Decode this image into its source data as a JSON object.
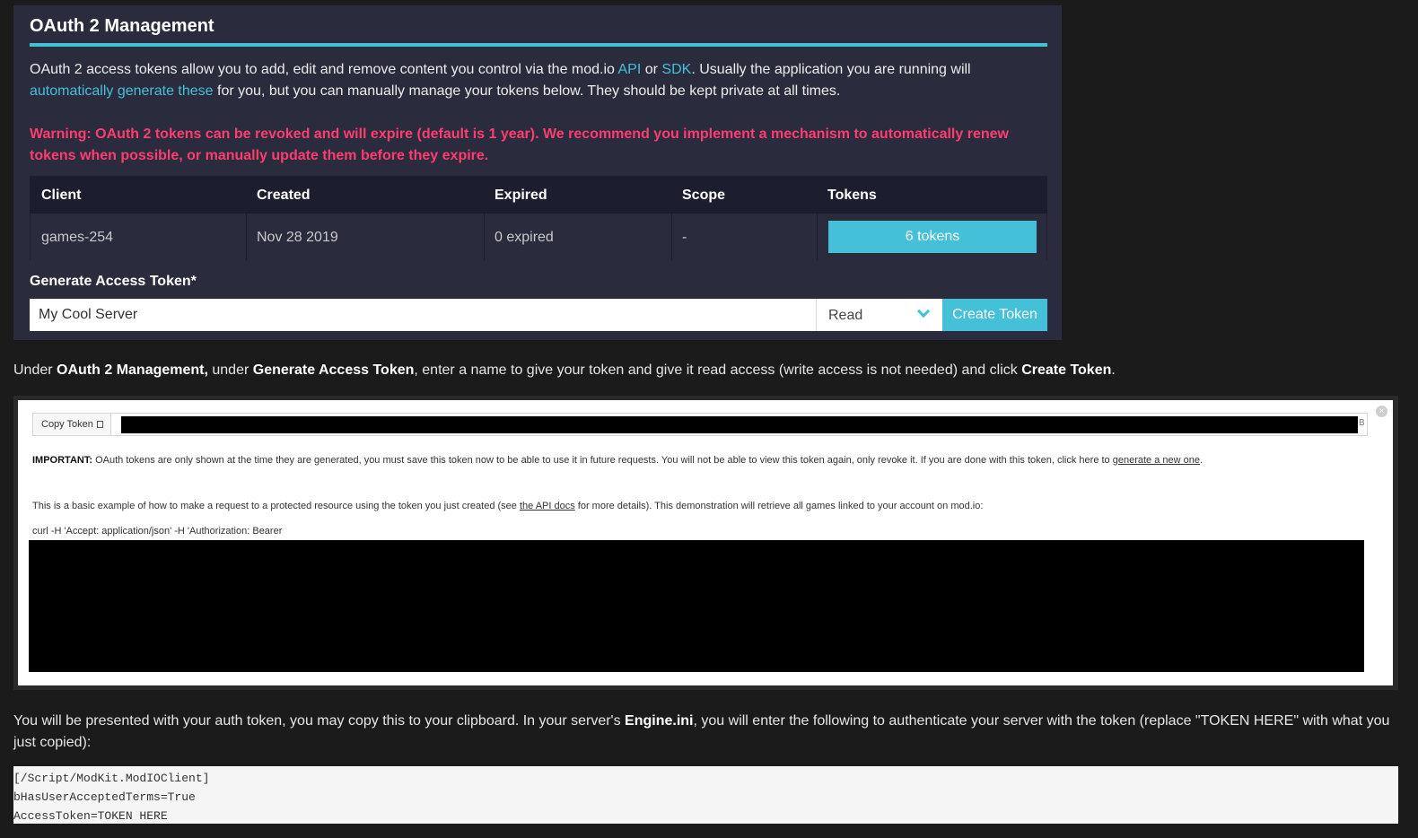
{
  "panel": {
    "title": "OAuth 2 Management",
    "desc_1": "OAuth 2 access tokens allow you to add, edit and remove content you control via the mod.io ",
    "link_api": "API",
    "desc_or": " or ",
    "link_sdk": "SDK",
    "desc_2": ". Usually the application you are running will ",
    "link_auto": "automatically generate these",
    "desc_3": " for you, but you can manually manage your tokens below. They should be kept private at all times.",
    "warning": "Warning: OAuth 2 tokens can be revoked and will expire (default is 1 year). We recommend you implement a mechanism to automatically renew tokens when possible, or manually update them before they expire.",
    "colors": {
      "accent": "#44c1d8",
      "warning": "#ff3d6e",
      "panel_bg": "#2a2b3d"
    }
  },
  "table": {
    "headers": [
      "Client",
      "Created",
      "Expired",
      "Scope",
      "Tokens"
    ],
    "row": {
      "client": "games-254",
      "created": "Nov 28 2019",
      "expired": "0 expired",
      "scope": "-",
      "tokens_button": "6 tokens"
    }
  },
  "generate": {
    "label": "Generate Access Token*",
    "input_value": "My Cool Server",
    "scope_selected": "Read",
    "create_button": "Create Token"
  },
  "instruction1": {
    "a": "Under ",
    "b": "OAuth 2 Management,",
    "c": " under ",
    "d": "Generate Access Token",
    "e": ", enter a name to give your token and give it read access (write access is not needed) and click ",
    "f": "Create Token",
    "g": "."
  },
  "token_panel": {
    "copy_button": "Copy Token",
    "token_tail": "B",
    "important_label": "IMPORTANT:",
    "important_text": " OAuth tokens are only shown at the time they are generated, you must save this token now to be able to use it in future requests. You will not be able to view this token again, only revoke it. If you are done with this token, click here to ",
    "important_link": "generate a new one",
    "important_end": ".",
    "example_1": "This is a basic example of how to make a request to a protected resource using the token you just created (see ",
    "example_link": "the API docs",
    "example_2": " for more details). This demonstration will retrieve all games linked to your account on mod.io:",
    "curl": "curl -H 'Accept: application/json' -H 'Authorization: Bearer"
  },
  "instruction2": {
    "a": "You will be presented with your auth token, you may copy this to your clipboard. In your server's ",
    "b": "Engine.ini",
    "c": ", you will enter the following to authenticate your server with the token (replace \"TOKEN HERE\" with what you just copied):"
  },
  "code": {
    "lines": [
      "[/Script/ModKit.ModIOClient]",
      "bHasUserAcceptedTerms=True",
      "AccessToken=TOKEN HERE"
    ]
  }
}
